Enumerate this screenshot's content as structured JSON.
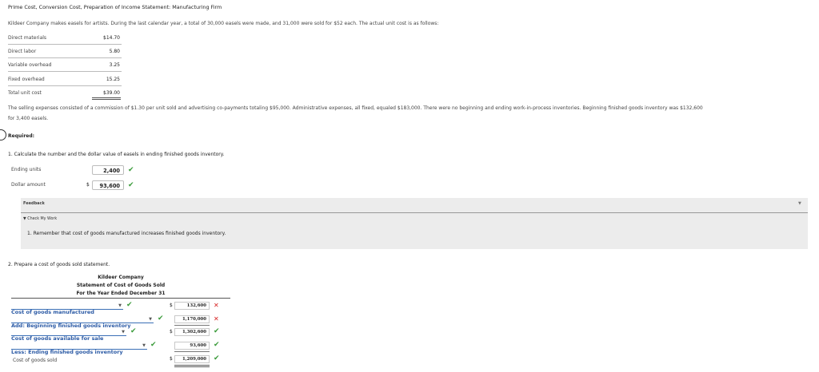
{
  "header": {
    "title": "Prime Cost, Conversion Cost, Preparation of Income Statement: Manufacturing Firm",
    "intro": "Kildeer Company makes easels for artists. During the last calendar year, a total of 30,000 easels were made, and 31,000 were sold for $52 each. The actual unit cost is as follows:"
  },
  "unit_costs": [
    {
      "label": "Direct materials",
      "value": "$14.70"
    },
    {
      "label": "Direct labor",
      "value": "5.80"
    },
    {
      "label": "Variable overhead",
      "value": "3.25"
    },
    {
      "label": "Fixed overhead",
      "value": "15.25"
    },
    {
      "label": "Total unit cost",
      "value": "$39.00"
    }
  ],
  "expenses_text_line1": "The selling expenses consisted of a commission of $1.30 per unit sold and advertising co-payments totaling $95,000. Administrative expenses, all fixed, equaled $183,000. There were no beginning and ending work-in-process inventories. Beginning finished goods inventory was $132,600",
  "expenses_text_line2": "for 3,400 easels.",
  "required_label": "Required:",
  "part1": {
    "question": "1. Calculate the number and the dollar value of easels in ending finished goods inventory.",
    "ending_units_label": "Ending units",
    "ending_units_value": "2,400",
    "dollar_amount_label": "Dollar amount",
    "dollar_sign": "$",
    "dollar_amount_value": "93,600"
  },
  "feedback": {
    "title": "Feedback",
    "check_my_work": "▼ Check My Work",
    "message": "1. Remember that cost of goods manufactured increases finished goods inventory.",
    "collapse_arrow": "▼"
  },
  "part2": {
    "question": "2. Prepare a cost of goods sold statement.",
    "company": "Kildeer Company",
    "statement": "Statement of Cost of Goods Sold",
    "period": "For the Year Ended December 31",
    "rows": [
      {
        "label": "Cost of goods manufactured",
        "dollar": "$",
        "value": "132,600",
        "status": "wrong"
      },
      {
        "label": "Add: Beginning finished goods inventory",
        "dollar": "",
        "value": "1,170,000",
        "status": "wrong"
      },
      {
        "label": "Cost of goods available for sale",
        "dollar": "$",
        "value": "1,302,600",
        "status": "correct"
      },
      {
        "label": "Less: Ending finished goods inventory",
        "dollar": "",
        "value": "93,600",
        "status": "correct"
      },
      {
        "label": "Cost of goods sold",
        "dollar": "$",
        "value": "1,209,000",
        "status": "correct"
      }
    ]
  },
  "colors": {
    "correct": "#3a9b3a",
    "wrong": "#d62020",
    "link_blue": "#2b5aa5"
  }
}
